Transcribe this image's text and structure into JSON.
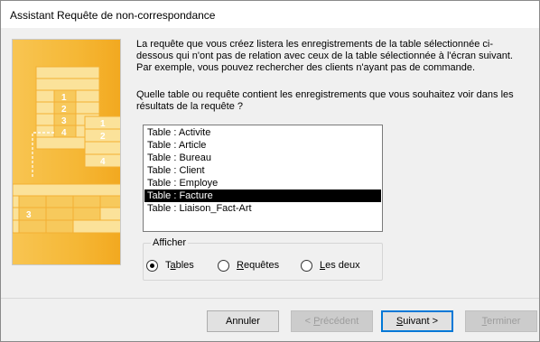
{
  "window": {
    "title": "Assistant Requête de non-correspondance"
  },
  "description": {
    "line1": "La requête que vous créez listera les enregistrements de la table sélectionnée ci-",
    "line2": "dessous qui n'ont pas de relation avec ceux de la table sélectionnée à l'écran suivant.",
    "line3": "Par exemple, vous pouvez rechercher des clients n'ayant pas de commande."
  },
  "question": {
    "line1": "Quelle table ou requête contient les enregistrements que vous souhaitez voir dans les",
    "line2": "résultats de la requête ?"
  },
  "tables": [
    "Table : Activite",
    "Table : Article",
    "Table : Bureau",
    "Table : Client",
    "Table : Employe",
    "Table : Facture",
    "Table : Liaison_Fact-Art"
  ],
  "selected_table": "Table : Facture",
  "filter": {
    "label": "Afficher",
    "options": [
      {
        "pre": "T",
        "acc": "a",
        "post": "bles",
        "checked": true
      },
      {
        "pre": "",
        "acc": "R",
        "post": "equêtes",
        "checked": false
      },
      {
        "pre": "",
        "acc": "L",
        "post": "es deux",
        "checked": false
      }
    ]
  },
  "illustration": {
    "numbers": [
      "1",
      "2",
      "3",
      "4",
      "1",
      "2",
      "4",
      "3"
    ]
  },
  "buttons": {
    "cancel": "Annuler",
    "previous": {
      "pre": "< ",
      "acc": "P",
      "post": "récédent"
    },
    "next": {
      "pre": "",
      "acc": "S",
      "post": "uivant >"
    },
    "finish": {
      "pre": "",
      "acc": "T",
      "post": "erminer"
    }
  },
  "colors": {
    "illustration_bg": "#f5b735",
    "illustration_light": "#fbe29a",
    "selection_bg": "#000000",
    "default_button_border": "#0078d7"
  }
}
